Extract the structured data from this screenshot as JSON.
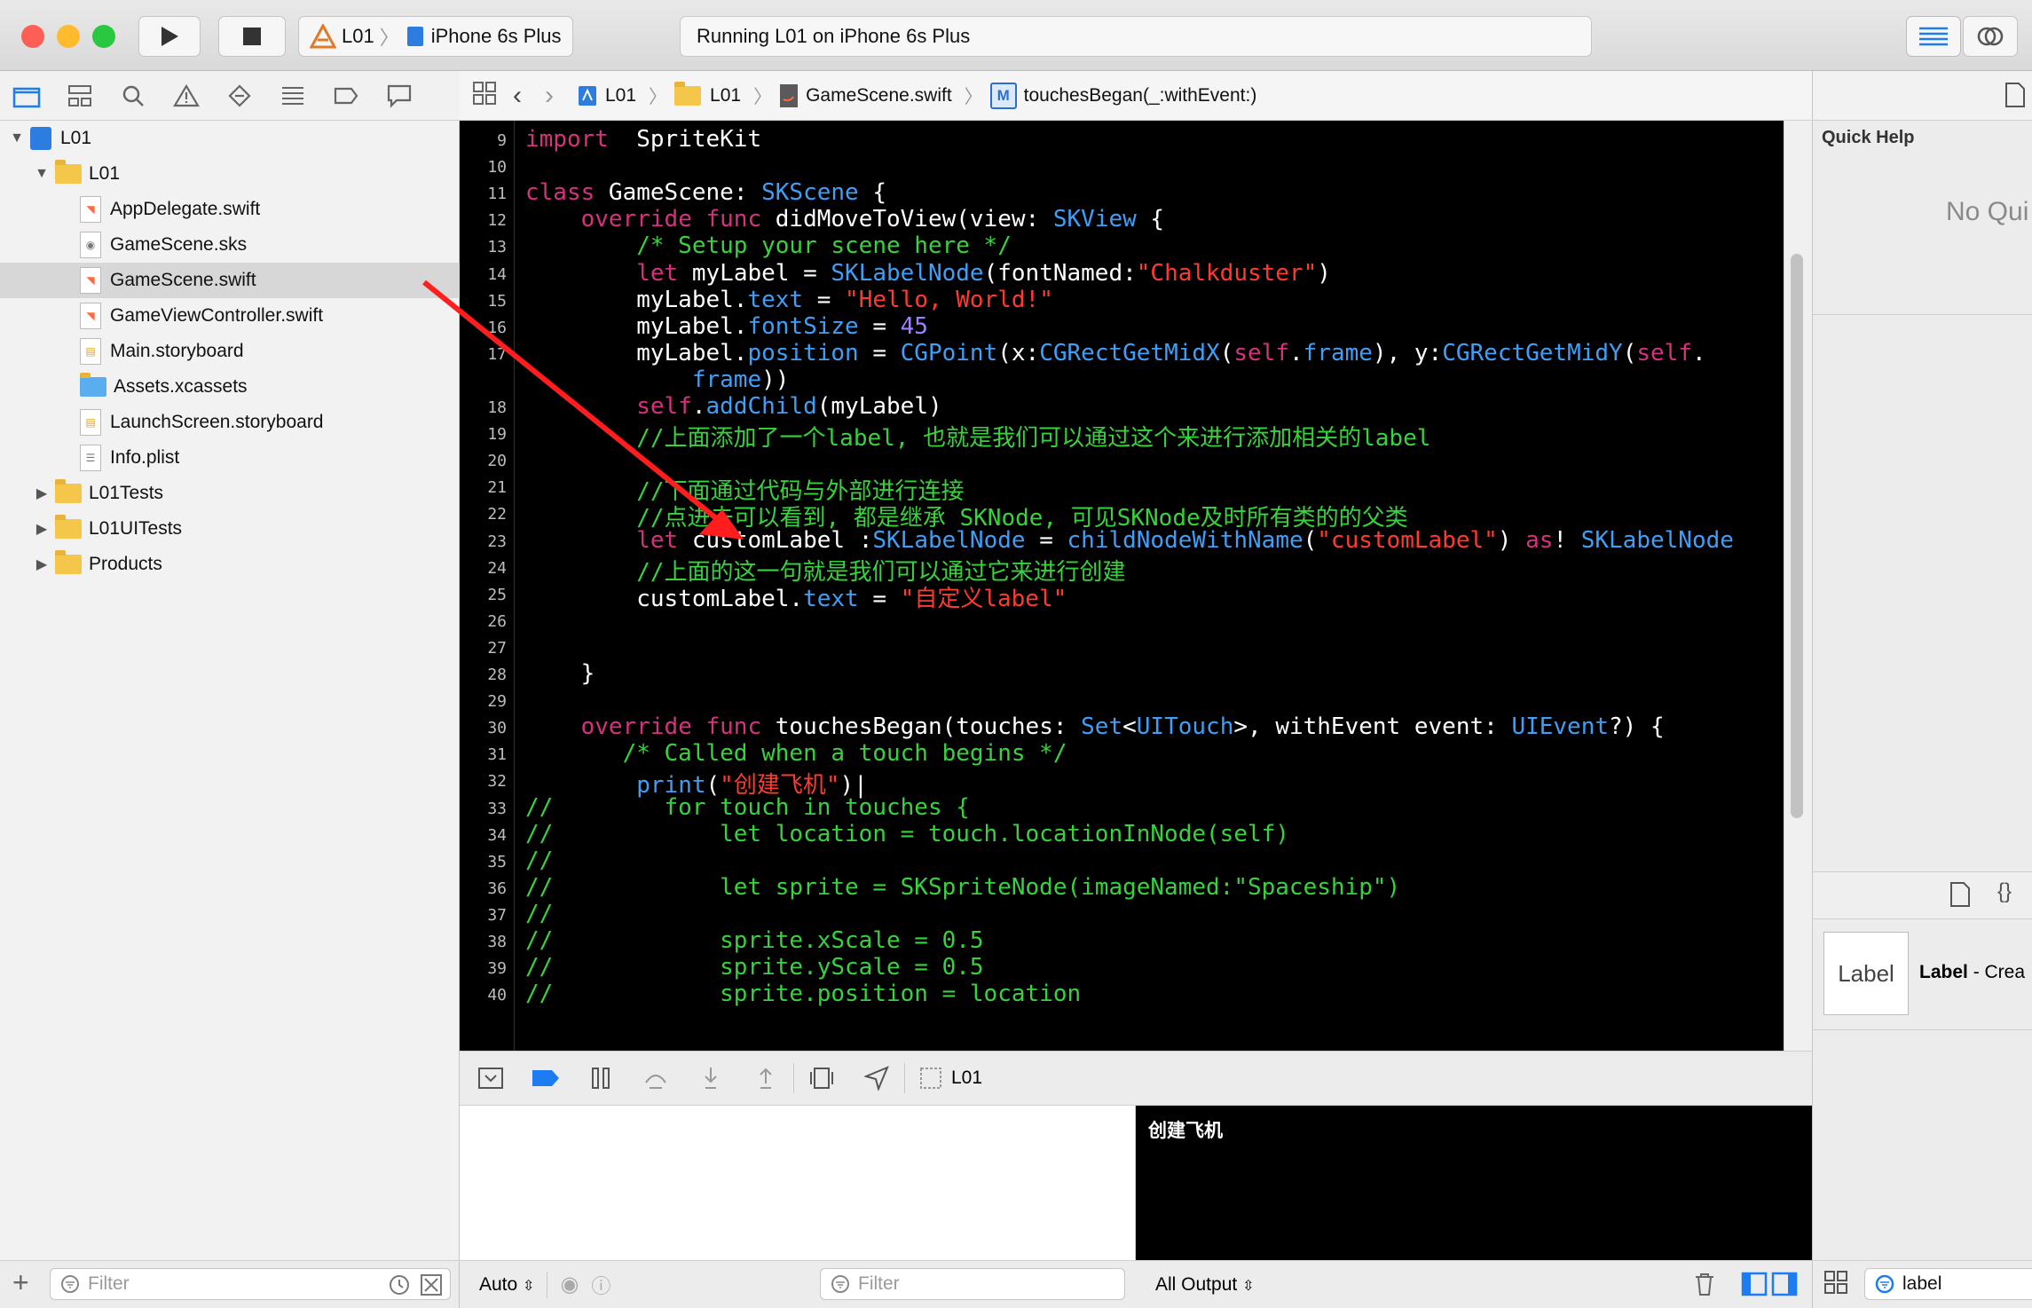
{
  "toolbar": {
    "scheme": "L01",
    "device": "iPhone 6s Plus",
    "status": "Running L01 on iPhone 6s Plus",
    "colors": {
      "close": "#fd5f57",
      "minimize": "#febb2e",
      "zoom": "#29c840",
      "accent": "#1d7cf2"
    }
  },
  "navigator": {
    "items": [
      {
        "label": "L01",
        "icon": "project-icon",
        "indent": 0,
        "disclosure": "open"
      },
      {
        "label": "L01",
        "icon": "folder-icon",
        "indent": 1,
        "disclosure": "open"
      },
      {
        "label": "AppDelegate.swift",
        "icon": "swift-file-icon",
        "indent": 2
      },
      {
        "label": "GameScene.sks",
        "icon": "sks-file-icon",
        "indent": 2
      },
      {
        "label": "GameScene.swift",
        "icon": "swift-file-icon",
        "indent": 2,
        "selected": true
      },
      {
        "label": "GameViewController.swift",
        "icon": "swift-file-icon",
        "indent": 2
      },
      {
        "label": "Main.storyboard",
        "icon": "storyboard-icon",
        "indent": 2
      },
      {
        "label": "Assets.xcassets",
        "icon": "assets-folder-icon",
        "indent": 2
      },
      {
        "label": "LaunchScreen.storyboard",
        "icon": "storyboard-icon",
        "indent": 2
      },
      {
        "label": "Info.plist",
        "icon": "plist-icon",
        "indent": 2
      },
      {
        "label": "L01Tests",
        "icon": "folder-icon",
        "indent": 1,
        "disclosure": "closed"
      },
      {
        "label": "L01UITests",
        "icon": "folder-icon",
        "indent": 1,
        "disclosure": "closed"
      },
      {
        "label": "Products",
        "icon": "folder-icon",
        "indent": 1,
        "disclosure": "closed"
      }
    ],
    "filter_placeholder": "Filter"
  },
  "jumpbar": {
    "crumbs": [
      "L01",
      "L01",
      "GameScene.swift",
      "touchesBegan(_:withEvent:)"
    ],
    "method_badge": "M"
  },
  "editor": {
    "line_numbers": [
      "9",
      "10",
      "11",
      "12",
      "13",
      "14",
      "15",
      "16",
      "17",
      "",
      "18",
      "19",
      "20",
      "21",
      "22",
      "23",
      "24",
      "25",
      "26",
      "27",
      "28",
      "29",
      "30",
      "31",
      "32",
      "33",
      "34",
      "35",
      "36",
      "37",
      "38",
      "39",
      "40"
    ],
    "lines": [
      [
        [
          "kw",
          "import"
        ],
        [
          "",
          "  SpriteKit"
        ]
      ],
      [],
      [
        [
          "kw",
          "class"
        ],
        [
          "",
          " GameScene: "
        ],
        [
          "ty",
          "SKScene"
        ],
        [
          "",
          " {"
        ]
      ],
      [
        [
          "",
          "    "
        ],
        [
          "kw",
          "override func"
        ],
        [
          "",
          " didMoveToView(view: "
        ],
        [
          "ty",
          "SKView"
        ],
        [
          "",
          " {"
        ]
      ],
      [
        [
          "cm",
          "        /* Setup your scene here */"
        ]
      ],
      [
        [
          "",
          "        "
        ],
        [
          "kw",
          "let"
        ],
        [
          "",
          " myLabel = "
        ],
        [
          "ty",
          "SKLabelNode"
        ],
        [
          "",
          "(fontNamed:"
        ],
        [
          "st",
          "\"Chalkduster\""
        ],
        [
          "",
          ")"
        ]
      ],
      [
        [
          "",
          "        myLabel."
        ],
        [
          "ty",
          "text"
        ],
        [
          "",
          " = "
        ],
        [
          "st",
          "\"Hello, World!\""
        ]
      ],
      [
        [
          "",
          "        myLabel."
        ],
        [
          "ty",
          "fontSize"
        ],
        [
          "",
          " = "
        ],
        [
          "nu",
          "45"
        ]
      ],
      [
        [
          "",
          "        myLabel."
        ],
        [
          "ty",
          "position"
        ],
        [
          "",
          " = "
        ],
        [
          "ty",
          "CGPoint"
        ],
        [
          "",
          "(x:"
        ],
        [
          "ty",
          "CGRectGetMidX"
        ],
        [
          "",
          "("
        ],
        [
          "kw",
          "self"
        ],
        [
          "",
          "."
        ],
        [
          "ty",
          "frame"
        ],
        [
          "",
          "), y:"
        ],
        [
          "ty",
          "CGRectGetMidY"
        ],
        [
          "",
          "("
        ],
        [
          "kw",
          "self"
        ],
        [
          "",
          "."
        ]
      ],
      [
        [
          "",
          "            "
        ],
        [
          "ty",
          "frame"
        ],
        [
          "",
          "))"
        ]
      ],
      [
        [
          "",
          "        "
        ],
        [
          "kw",
          "self"
        ],
        [
          "",
          "."
        ],
        [
          "ty",
          "addChild"
        ],
        [
          "",
          "(myLabel)"
        ]
      ],
      [
        [
          "cm",
          "        //上面添加了一个label, 也就是我们可以通过这个来进行添加相关的label"
        ]
      ],
      [],
      [
        [
          "cm",
          "        //下面通过代码与外部进行连接"
        ]
      ],
      [
        [
          "cm",
          "        //点进去可以看到, 都是继承 SKNode, 可见SKNode及时所有类的的父类"
        ]
      ],
      [
        [
          "",
          "        "
        ],
        [
          "kw",
          "let"
        ],
        [
          "",
          " customLabel :"
        ],
        [
          "ty",
          "SKLabelNode"
        ],
        [
          "",
          " = "
        ],
        [
          "ty",
          "childNodeWithName"
        ],
        [
          "",
          "("
        ],
        [
          "st",
          "\"customLabel\""
        ],
        [
          "",
          ") "
        ],
        [
          "kw",
          "as"
        ],
        [
          "",
          "! "
        ],
        [
          "ty",
          "SKLabelNode"
        ]
      ],
      [
        [
          "cm",
          "        //上面的这一句就是我们可以通过它来进行创建"
        ]
      ],
      [
        [
          "",
          "        customLabel."
        ],
        [
          "ty",
          "text"
        ],
        [
          "",
          " = "
        ],
        [
          "st",
          "\"自定义label\""
        ]
      ],
      [],
      [],
      [
        [
          "",
          "    }"
        ]
      ],
      [],
      [
        [
          "",
          "    "
        ],
        [
          "kw",
          "override func"
        ],
        [
          "",
          " touchesBegan(touches: "
        ],
        [
          "ty",
          "Set"
        ],
        [
          "",
          "<"
        ],
        [
          "ty",
          "UITouch"
        ],
        [
          "",
          ">, withEvent event: "
        ],
        [
          "ty",
          "UIEvent"
        ],
        [
          "",
          "?) {"
        ]
      ],
      [
        [
          "cm",
          "       /* Called when a touch begins */"
        ]
      ],
      [
        [
          "",
          "        "
        ],
        [
          "ty",
          "print"
        ],
        [
          "",
          "("
        ],
        [
          "st",
          "\"创建飞机\""
        ],
        [
          "",
          ")|"
        ]
      ],
      [
        [
          "cm",
          "//        for touch in touches {"
        ]
      ],
      [
        [
          "cm",
          "//            let location = touch.locationInNode(self)"
        ]
      ],
      [
        [
          "cm",
          "//"
        ]
      ],
      [
        [
          "cm",
          "//            let sprite = SKSpriteNode(imageNamed:\"Spaceship\")"
        ]
      ],
      [
        [
          "cm",
          "//"
        ]
      ],
      [
        [
          "cm",
          "//            sprite.xScale = 0.5"
        ]
      ],
      [
        [
          "cm",
          "//            sprite.yScale = 0.5"
        ]
      ],
      [
        [
          "cm",
          "//            sprite.position = location"
        ]
      ]
    ]
  },
  "debug": {
    "target": "L01",
    "auto_label": "Auto",
    "filter_placeholder": "Filter",
    "output_label": "All Output",
    "console_text": "创建飞机"
  },
  "inspector": {
    "quick_help_title": "Quick Help",
    "quick_help_empty": "No Qui",
    "library_item_thumb": "Label",
    "library_item_title": "Label",
    "library_item_desc": " - Crea",
    "search_value": "label"
  }
}
